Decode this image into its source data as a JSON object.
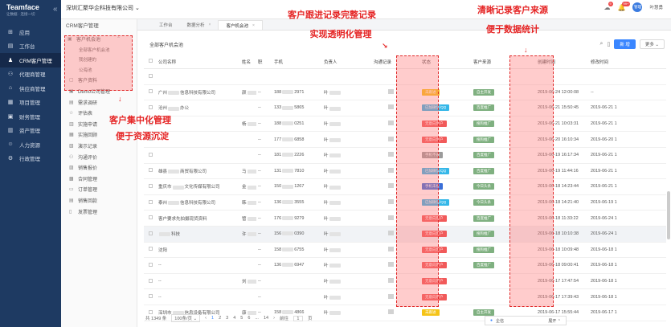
{
  "brand": {
    "name": "Teamface",
    "slogan": "让数据 · 连接一切"
  },
  "company": "深圳汇聚华企科技有限公司",
  "user": {
    "avatar": "管理",
    "name": "叶慧勇"
  },
  "notifications": [
    {
      "icon": "cloud-icon",
      "count": "9"
    },
    {
      "icon": "bell-icon",
      "count": "99+"
    }
  ],
  "nav": [
    {
      "icon": "apps-icon",
      "label": "应用"
    },
    {
      "icon": "desk-icon",
      "label": "工作台"
    },
    {
      "icon": "crm-icon",
      "label": "CRM客户管理",
      "active": true
    },
    {
      "icon": "agent-icon",
      "label": "代理商管理"
    },
    {
      "icon": "supplier-icon",
      "label": "供应商管理"
    },
    {
      "icon": "project-icon",
      "label": "项目管理"
    },
    {
      "icon": "finance-icon",
      "label": "财务管理"
    },
    {
      "icon": "asset-icon",
      "label": "资产管理"
    },
    {
      "icon": "hr-icon",
      "label": "人力资源"
    },
    {
      "icon": "admin-icon",
      "label": "行政管理"
    }
  ],
  "crm_menu": {
    "title": "CRM客户管理",
    "group": "客户机会池",
    "subs": [
      "全部客户机会池",
      "我创建的",
      "公海池"
    ],
    "items": [
      "客户资料",
      "Demo公司管理",
      "需求调研",
      "评估表",
      "实施申请",
      "实施回顾",
      "演示记录",
      "沟通评价",
      "销售报价",
      "合同管理",
      "订单管理",
      "销售回款",
      "发票管理"
    ]
  },
  "tabs": [
    {
      "label": "工作台"
    },
    {
      "label": "数据分析"
    },
    {
      "label": "客户机会池",
      "active": true
    }
  ],
  "main": {
    "subtitle": "全部客户机会池",
    "new_label": "新 增",
    "more_label": "更多"
  },
  "columns": [
    "公司名称",
    "姓名",
    "职",
    "手机",
    "负责人",
    "沟通记录",
    "状态",
    "客户来源",
    "创建时间",
    "修改时间"
  ],
  "rows": [
    {
      "company": "",
      "name": "",
      "phone": "",
      "owner": "",
      "status": "",
      "status_color": "",
      "source": "",
      "created": "",
      "modified": ""
    },
    {
      "company": "广州____信息科技有限公司",
      "name": "颜",
      "phone": "188____2971",
      "owner": "叶",
      "status": "未跟进",
      "status_color": "#f5c418",
      "source": "自主开发",
      "created": "2019-06-24 12:00:08",
      "modified": "--"
    },
    {
      "company": "沧州____办公",
      "name": "",
      "phone": "133____5865",
      "owner": "叶",
      "status": "已加微信/QQ",
      "status_color": "#34b7e8",
      "source": "百度推广",
      "created": "2019-06-21 15:50:45",
      "modified": "2019-06-21 1"
    },
    {
      "company": "",
      "name": "杨",
      "phone": "188____0251",
      "owner": "叶",
      "status": "无意向客户",
      "status_color": "#f15a5a",
      "source": "搜狗推广",
      "created": "2019-06-21 10:03:31",
      "modified": "2019-06-21 1"
    },
    {
      "company": "",
      "name": "",
      "phone": "177____6858",
      "owner": "叶",
      "status": "无意向客户",
      "status_color": "#f15a5a",
      "source": "搜狗推广",
      "created": "2019-06-20 16:10:34",
      "modified": "2019-06-20 1"
    },
    {
      "company": "",
      "name": "",
      "phone": "181____2226",
      "owner": "叶",
      "status": "手机不通",
      "status_color": "#9b9b9b",
      "source": "百度推广",
      "created": "2019-06-19 16:17:34",
      "modified": "2019-06-21 1"
    },
    {
      "company": "雄县____商贸有限公司",
      "name": "马",
      "phone": "131____7810",
      "owner": "叶",
      "status": "已加微信/QQ",
      "status_color": "#34b7e8",
      "source": "百度推广",
      "created": "2019-06-19 11:44:16",
      "modified": "2019-06-21 1"
    },
    {
      "company": "重庆市____文化传媒有限公司",
      "name": "金",
      "phone": "150____1267",
      "owner": "叶",
      "status": "手机未接",
      "status_color": "#3a6fd8",
      "source": "今日头条",
      "created": "2019-06-18 14:23:44",
      "modified": "2019-06-21 1"
    },
    {
      "company": "泰州____信息科技有限公司",
      "name": "韩",
      "phone": "136____3555",
      "owner": "叶",
      "status": "已加微信/QQ",
      "status_color": "#34b7e8",
      "source": "今日头条",
      "created": "2019-06-18 14:21:40",
      "modified": "2019-06-19 1"
    },
    {
      "company": "客户要求先拍摄现货资料",
      "name": "管",
      "phone": "176____9279",
      "owner": "叶",
      "status": "无意向客户",
      "status_color": "#f15a5a",
      "source": "百度推广",
      "created": "2019-06-18 11:33:22",
      "modified": "2019-06-24 1"
    },
    {
      "company": "____科技",
      "name": "许",
      "phone": "156____0390",
      "owner": "叶",
      "status": "无意向客户",
      "status_color": "#f15a5a",
      "source": "搜狗推广",
      "created": "2019-06-18 10:10:38",
      "modified": "2019-06-24 1",
      "highlight": true
    },
    {
      "company": "沈阳",
      "name": "",
      "phone": "158____6755",
      "owner": "叶",
      "status": "无意向客户",
      "status_color": "#f15a5a",
      "source": "搜狗推广",
      "created": "2019-06-18 10:09:48",
      "modified": "2019-06-18 1"
    },
    {
      "company": "--",
      "name": "",
      "phone": "136____6947",
      "owner": "叶",
      "status": "无意向客户",
      "status_color": "#f15a5a",
      "source": "百度推广",
      "created": "2019-06-18 09:00:41",
      "modified": "2019-06-18 1"
    },
    {
      "company": "--",
      "name": "刘",
      "phone": "",
      "owner": "叶",
      "status": "无意向客户",
      "status_color": "#f15a5a",
      "source": "",
      "created": "2019-06-17 17:47:54",
      "modified": "2019-06-18 1"
    },
    {
      "company": "--",
      "name": "",
      "phone": "",
      "owner": "叶",
      "status": "无意向客户",
      "status_color": "#f15a5a",
      "source": "",
      "created": "2019-06-17 17:39:43",
      "modified": "2019-06-18 1"
    },
    {
      "company": "深圳市____信息设备有限公司",
      "name": "康",
      "phone": "158____4866",
      "owner": "叶",
      "status": "未跟进",
      "status_color": "#f5c418",
      "source": "自主开发",
      "created": "2019-06-17 15:55:44",
      "modified": "2019-06-17 1"
    }
  ],
  "pager": {
    "total": "共 1349 条",
    "page_size": "100条/页",
    "pages": [
      "1",
      "2",
      "3",
      "4",
      "5",
      "6",
      "...",
      "14"
    ],
    "goto_label": "前往",
    "goto_value": "1",
    "goto_suffix": "页"
  },
  "chat": {
    "label": "企信",
    "expand": "展开"
  },
  "callouts": {
    "top_middle": [
      "客户跟进记录完整记录",
      "实现透明化管理"
    ],
    "top_right": [
      "清晰记录客户来源",
      "便于数据统计"
    ],
    "left": [
      "客户集中化管理",
      "便于资源沉淀"
    ]
  }
}
